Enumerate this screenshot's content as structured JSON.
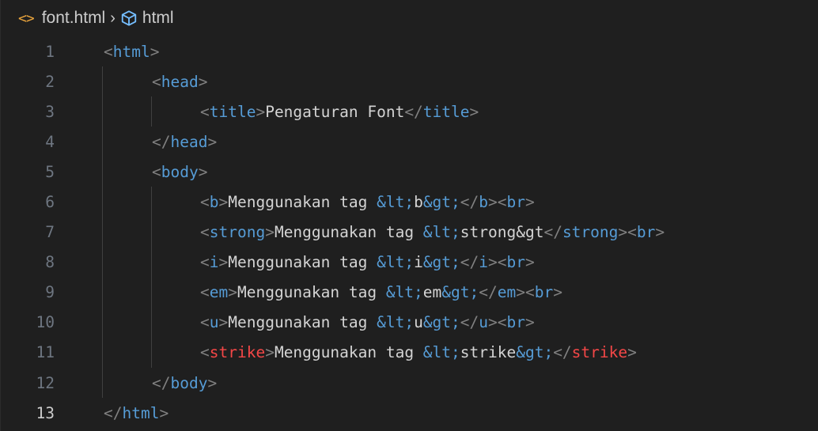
{
  "breadcrumb": {
    "file_icon": "file-code-icon",
    "file_name": "font.html",
    "separator": "›",
    "element_icon": "cube-icon",
    "element_name": "html"
  },
  "colors": {
    "background": "#1f1f1f",
    "tag": "#569cd6",
    "punctuation": "#808080",
    "text": "#d4d4d4",
    "deprecated_tag": "#f44747",
    "line_number": "#6e7681",
    "active_line_number": "#cccccc",
    "file_icon": "#e8a33c"
  },
  "editor": {
    "active_line": 13,
    "lines": [
      {
        "number": "1",
        "indent": 0,
        "tokens": [
          {
            "t": "p",
            "v": "<"
          },
          {
            "t": "tag",
            "v": "html"
          },
          {
            "t": "p",
            "v": ">"
          }
        ]
      },
      {
        "number": "2",
        "indent": 1,
        "tokens": [
          {
            "t": "p",
            "v": "<"
          },
          {
            "t": "tag",
            "v": "head"
          },
          {
            "t": "p",
            "v": ">"
          }
        ]
      },
      {
        "number": "3",
        "indent": 2,
        "tokens": [
          {
            "t": "p",
            "v": "<"
          },
          {
            "t": "tag",
            "v": "title"
          },
          {
            "t": "p",
            "v": ">"
          },
          {
            "t": "text",
            "v": "Pengaturan Font"
          },
          {
            "t": "p",
            "v": "</"
          },
          {
            "t": "tag",
            "v": "title"
          },
          {
            "t": "p",
            "v": ">"
          }
        ]
      },
      {
        "number": "4",
        "indent": 1,
        "tokens": [
          {
            "t": "p",
            "v": "</"
          },
          {
            "t": "tag",
            "v": "head"
          },
          {
            "t": "p",
            "v": ">"
          }
        ]
      },
      {
        "number": "5",
        "indent": 1,
        "tokens": [
          {
            "t": "p",
            "v": "<"
          },
          {
            "t": "tag",
            "v": "body"
          },
          {
            "t": "p",
            "v": ">"
          }
        ]
      },
      {
        "number": "6",
        "indent": 2,
        "tokens": [
          {
            "t": "p",
            "v": "<"
          },
          {
            "t": "tag",
            "v": "b"
          },
          {
            "t": "p",
            "v": ">"
          },
          {
            "t": "text",
            "v": "Menggunakan tag "
          },
          {
            "t": "entity",
            "v": "&lt;"
          },
          {
            "t": "text",
            "v": "b"
          },
          {
            "t": "entity",
            "v": "&gt;"
          },
          {
            "t": "p",
            "v": "</"
          },
          {
            "t": "tag",
            "v": "b"
          },
          {
            "t": "p",
            "v": ">"
          },
          {
            "t": "p",
            "v": "<"
          },
          {
            "t": "tag",
            "v": "br"
          },
          {
            "t": "p",
            "v": ">"
          }
        ]
      },
      {
        "number": "7",
        "indent": 2,
        "tokens": [
          {
            "t": "p",
            "v": "<"
          },
          {
            "t": "tag",
            "v": "strong"
          },
          {
            "t": "p",
            "v": ">"
          },
          {
            "t": "text",
            "v": "Menggunakan tag "
          },
          {
            "t": "entity",
            "v": "&lt;"
          },
          {
            "t": "text",
            "v": "strong"
          },
          {
            "t": "text",
            "v": "&gt"
          },
          {
            "t": "p",
            "v": "</"
          },
          {
            "t": "tag",
            "v": "strong"
          },
          {
            "t": "p",
            "v": ">"
          },
          {
            "t": "p",
            "v": "<"
          },
          {
            "t": "tag",
            "v": "br"
          },
          {
            "t": "p",
            "v": ">"
          }
        ]
      },
      {
        "number": "8",
        "indent": 2,
        "tokens": [
          {
            "t": "p",
            "v": "<"
          },
          {
            "t": "tag",
            "v": "i"
          },
          {
            "t": "p",
            "v": ">"
          },
          {
            "t": "text",
            "v": "Menggunakan tag "
          },
          {
            "t": "entity",
            "v": "&lt;"
          },
          {
            "t": "text",
            "v": "i"
          },
          {
            "t": "entity",
            "v": "&gt;"
          },
          {
            "t": "p",
            "v": "</"
          },
          {
            "t": "tag",
            "v": "i"
          },
          {
            "t": "p",
            "v": ">"
          },
          {
            "t": "p",
            "v": "<"
          },
          {
            "t": "tag",
            "v": "br"
          },
          {
            "t": "p",
            "v": ">"
          }
        ]
      },
      {
        "number": "9",
        "indent": 2,
        "tokens": [
          {
            "t": "p",
            "v": "<"
          },
          {
            "t": "tag",
            "v": "em"
          },
          {
            "t": "p",
            "v": ">"
          },
          {
            "t": "text",
            "v": "Menggunakan tag "
          },
          {
            "t": "entity",
            "v": "&lt;"
          },
          {
            "t": "text",
            "v": "em"
          },
          {
            "t": "entity",
            "v": "&gt;"
          },
          {
            "t": "p",
            "v": "</"
          },
          {
            "t": "tag",
            "v": "em"
          },
          {
            "t": "p",
            "v": ">"
          },
          {
            "t": "p",
            "v": "<"
          },
          {
            "t": "tag",
            "v": "br"
          },
          {
            "t": "p",
            "v": ">"
          }
        ]
      },
      {
        "number": "10",
        "indent": 2,
        "tokens": [
          {
            "t": "p",
            "v": "<"
          },
          {
            "t": "tag",
            "v": "u"
          },
          {
            "t": "p",
            "v": ">"
          },
          {
            "t": "text",
            "v": "Menggunakan tag "
          },
          {
            "t": "entity",
            "v": "&lt;"
          },
          {
            "t": "text",
            "v": "u"
          },
          {
            "t": "entity",
            "v": "&gt;"
          },
          {
            "t": "p",
            "v": "</"
          },
          {
            "t": "tag",
            "v": "u"
          },
          {
            "t": "p",
            "v": ">"
          },
          {
            "t": "p",
            "v": "<"
          },
          {
            "t": "tag",
            "v": "br"
          },
          {
            "t": "p",
            "v": ">"
          }
        ]
      },
      {
        "number": "11",
        "indent": 2,
        "tokens": [
          {
            "t": "p",
            "v": "<"
          },
          {
            "t": "dep",
            "v": "strike"
          },
          {
            "t": "p",
            "v": ">"
          },
          {
            "t": "text",
            "v": "Menggunakan tag "
          },
          {
            "t": "entity",
            "v": "&lt;"
          },
          {
            "t": "text",
            "v": "strike"
          },
          {
            "t": "entity",
            "v": "&gt;"
          },
          {
            "t": "p",
            "v": "</"
          },
          {
            "t": "dep",
            "v": "strike"
          },
          {
            "t": "p",
            "v": ">"
          }
        ]
      },
      {
        "number": "12",
        "indent": 1,
        "tokens": [
          {
            "t": "p",
            "v": "</"
          },
          {
            "t": "tag",
            "v": "body"
          },
          {
            "t": "p",
            "v": ">"
          }
        ]
      },
      {
        "number": "13",
        "indent": 0,
        "tokens": [
          {
            "t": "p",
            "v": "</"
          },
          {
            "t": "tag",
            "v": "html"
          },
          {
            "t": "p",
            "v": ">"
          }
        ]
      }
    ]
  }
}
